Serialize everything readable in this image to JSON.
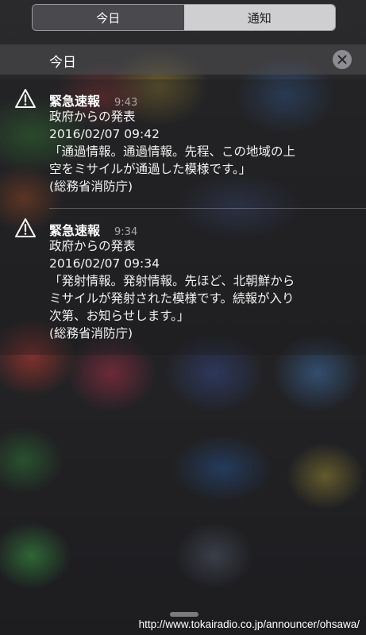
{
  "tabs": [
    {
      "label": "今日",
      "active": true
    },
    {
      "label": "通知",
      "active": false
    }
  ],
  "section": {
    "title": "今日",
    "clear_icon": "close-icon"
  },
  "notifications": [
    {
      "icon": "warning-icon",
      "title": "緊急速報",
      "time": "9:43",
      "body": "政府からの発表\n2016/02/07 09:42\n「通過情報。通過情報。先程、この地域の上\n空をミサイルが通過した模様です。」\n(総務省消防庁)"
    },
    {
      "icon": "warning-icon",
      "title": "緊急速報",
      "time": "9:34",
      "body": "政府からの発表\n2016/02/07 09:34\n「発射情報。発射情報。先ほど、北朝鮮から\nミサイルが発射された模様です。続報が入り\n次第、お知らせします。」\n(総務省消防庁)"
    }
  ],
  "watermark": "http://www.tokairadio.co.jp/announcer/ohsawa/"
}
